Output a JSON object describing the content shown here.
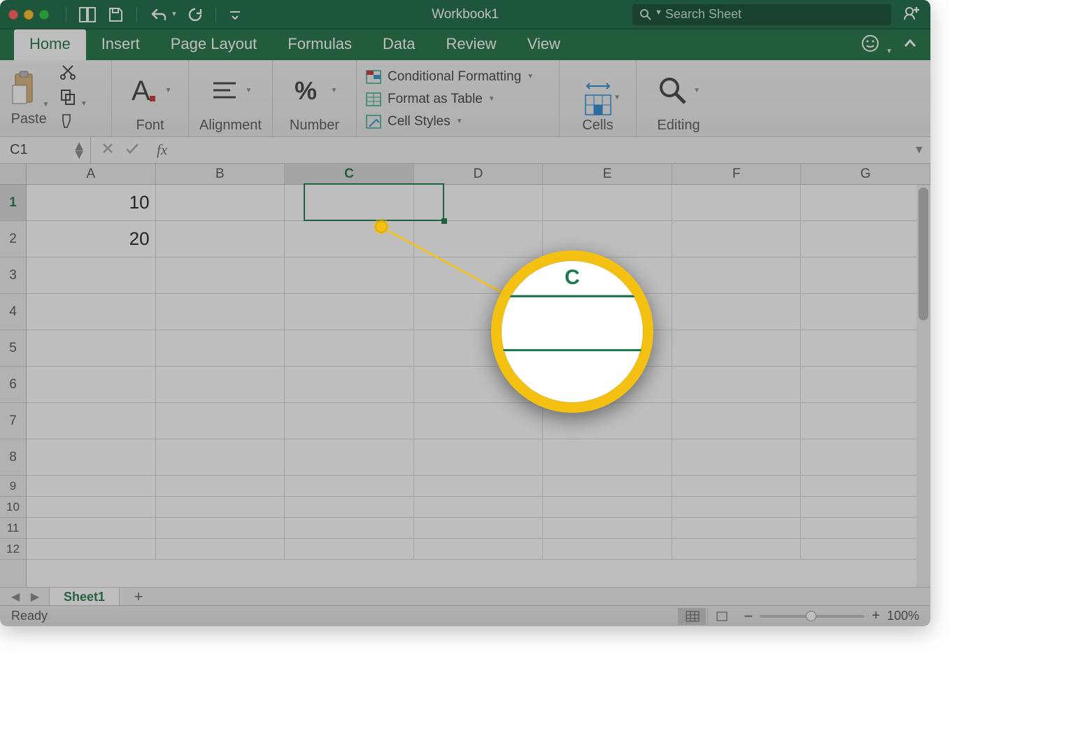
{
  "window": {
    "title": "Workbook1",
    "search_placeholder": "Search Sheet"
  },
  "tabs": [
    "Home",
    "Insert",
    "Page Layout",
    "Formulas",
    "Data",
    "Review",
    "View"
  ],
  "active_tab": "Home",
  "ribbon": {
    "paste": "Paste",
    "font": "Font",
    "alignment": "Alignment",
    "number": "Number",
    "conditional_formatting": "Conditional Formatting",
    "format_as_table": "Format as Table",
    "cell_styles": "Cell Styles",
    "cells": "Cells",
    "editing": "Editing"
  },
  "formula_bar": {
    "name_box": "C1",
    "fx_label": "fx",
    "formula": ""
  },
  "sheet": {
    "columns": [
      "A",
      "B",
      "C",
      "D",
      "E",
      "F",
      "G"
    ],
    "selected_column": "C",
    "selected_row": 1,
    "row_count": 12,
    "tall_rows": 8,
    "cells": {
      "A1": "10",
      "A2": "20"
    },
    "active_cell": "C1"
  },
  "sheettabs": {
    "tabs": [
      "Sheet1"
    ],
    "add": "+"
  },
  "statusbar": {
    "status": "Ready",
    "zoom": "100%",
    "zoom_minus": "−",
    "zoom_plus": "+"
  },
  "magnifier": {
    "column_label": "C"
  }
}
